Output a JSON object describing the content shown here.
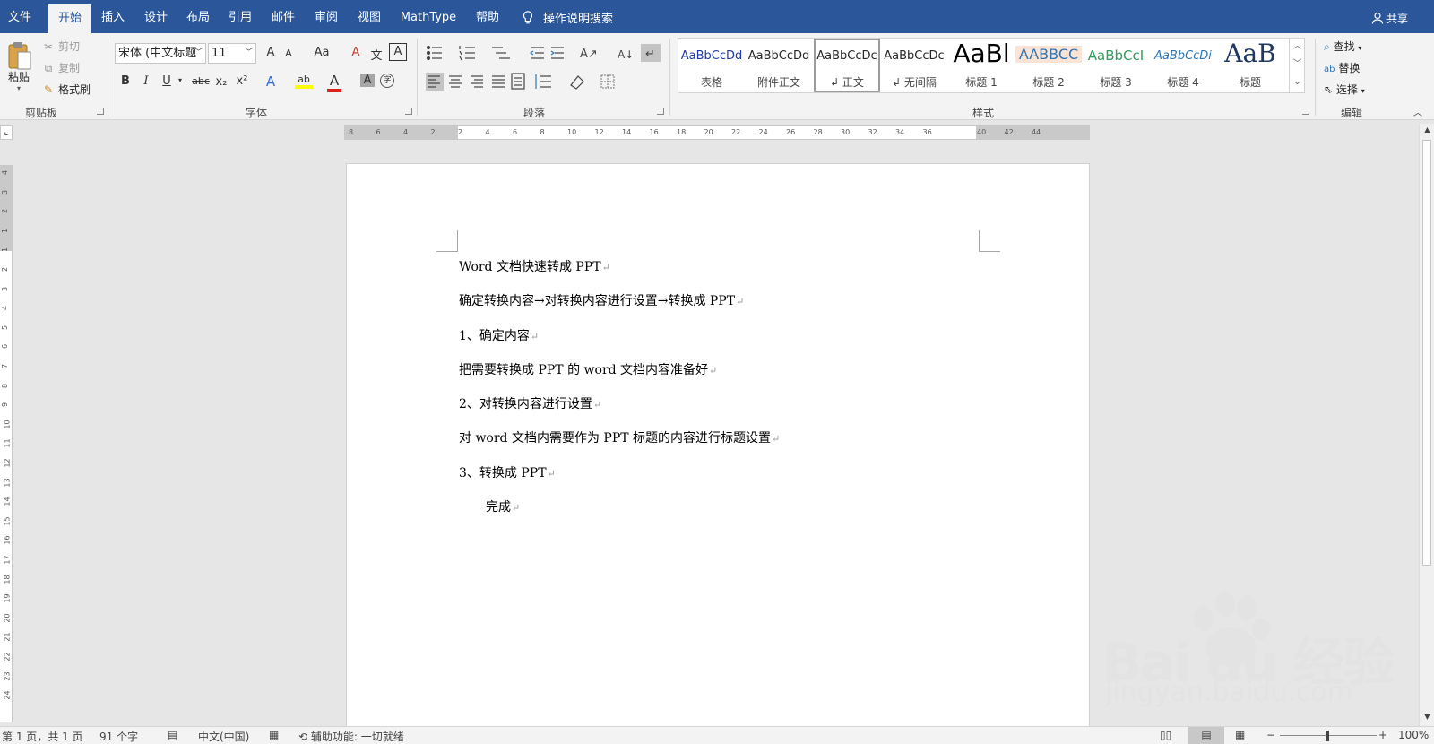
{
  "tabs": [
    {
      "label": "文件",
      "active": false
    },
    {
      "label": "开始",
      "active": true
    },
    {
      "label": "插入",
      "active": false
    },
    {
      "label": "设计",
      "active": false
    },
    {
      "label": "布局",
      "active": false
    },
    {
      "label": "引用",
      "active": false
    },
    {
      "label": "邮件",
      "active": false
    },
    {
      "label": "审阅",
      "active": false
    },
    {
      "label": "视图",
      "active": false
    },
    {
      "label": "MathType",
      "active": false
    },
    {
      "label": "帮助",
      "active": false
    }
  ],
  "tell_me": "操作说明搜索",
  "share": "共享",
  "clipboard": {
    "paste": "粘贴",
    "cut": "剪切",
    "copy": "复制",
    "format_painter": "格式刷",
    "group_label": "剪贴板"
  },
  "font": {
    "name": "宋体 (中文标题",
    "size": "11",
    "group_label": "字体",
    "case_label": "Aa",
    "grow_label": "A",
    "shrink_label": "A",
    "bold": "B",
    "italic": "I",
    "underline": "U",
    "strike": "abc",
    "subscript": "x₂",
    "superscript": "x²",
    "effects": "A",
    "highlight": "ab",
    "color": "A",
    "shade": "A",
    "enclose": "字",
    "phonetic": "文",
    "border": "A",
    "clear": "A"
  },
  "paragraph": {
    "group_label": "段落"
  },
  "styles": {
    "group_label": "样式",
    "items": [
      {
        "sample": "AaBbCcDd",
        "name": "表格",
        "color": "#1f3aa8"
      },
      {
        "sample": "AaBbCcDd",
        "name": "附件正文",
        "color": "#262626"
      },
      {
        "sample": "AaBbCcDc",
        "name": "↲ 正文",
        "color": "#262626",
        "selected": true
      },
      {
        "sample": "AaBbCcDc",
        "name": "↲ 无间隔",
        "color": "#262626"
      },
      {
        "sample": "AaBl",
        "name": "标题 1",
        "color": "#000000",
        "big": true
      },
      {
        "sample": "AABBCC",
        "name": "标题 2",
        "color": "#2e75b6",
        "bg": "#fbe4d5"
      },
      {
        "sample": "AaBbCcI",
        "name": "标题 3",
        "color": "#2e9e5b"
      },
      {
        "sample": "AaBbCcDi",
        "name": "标题 4",
        "color": "#2e75b6",
        "italic": true
      },
      {
        "sample": "AaB",
        "name": "标题",
        "color": "#1f3864",
        "big": true
      }
    ]
  },
  "editing": {
    "find": "查找",
    "replace": "替换",
    "select": "选择",
    "group_label": "编辑"
  },
  "ruler": {
    "h_labels": [
      "8",
      "6",
      "4",
      "2",
      "2",
      "4",
      "6",
      "8",
      "10",
      "12",
      "14",
      "16",
      "18",
      "20",
      "22",
      "24",
      "26",
      "28",
      "30",
      "32",
      "34",
      "36",
      "40",
      "42",
      "44"
    ],
    "v_labels": [
      "4",
      "3",
      "2",
      "1",
      "1",
      "2",
      "3",
      "4",
      "5",
      "6",
      "7",
      "8",
      "9",
      "10",
      "11",
      "12",
      "13",
      "14",
      "15",
      "16",
      "17",
      "18",
      "19",
      "20",
      "21",
      "22",
      "23",
      "24"
    ]
  },
  "document": {
    "paragraphs": [
      "Word 文档快速转成 PPT",
      "确定转换内容→对转换内容进行设置→转换成 PPT",
      "1、确定内容",
      "把需要转换成 PPT 的 word 文档内容准备好",
      "2、对转换内容进行设置",
      "对 word 文档内需要作为 PPT 标题的内容进行标题设置",
      "3、转换成 PPT",
      "完成"
    ],
    "para_mark": "↵"
  },
  "status": {
    "page": "第 1 页，共 1 页",
    "words": "91 个字",
    "language": "中文(中国)",
    "accessibility": "辅助功能: 一切就绪",
    "zoom_minus": "−",
    "zoom_plus": "+",
    "zoom": "100%"
  },
  "watermark": {
    "brand": "Bai du 经验",
    "url": "jingyan.baidu.com"
  }
}
